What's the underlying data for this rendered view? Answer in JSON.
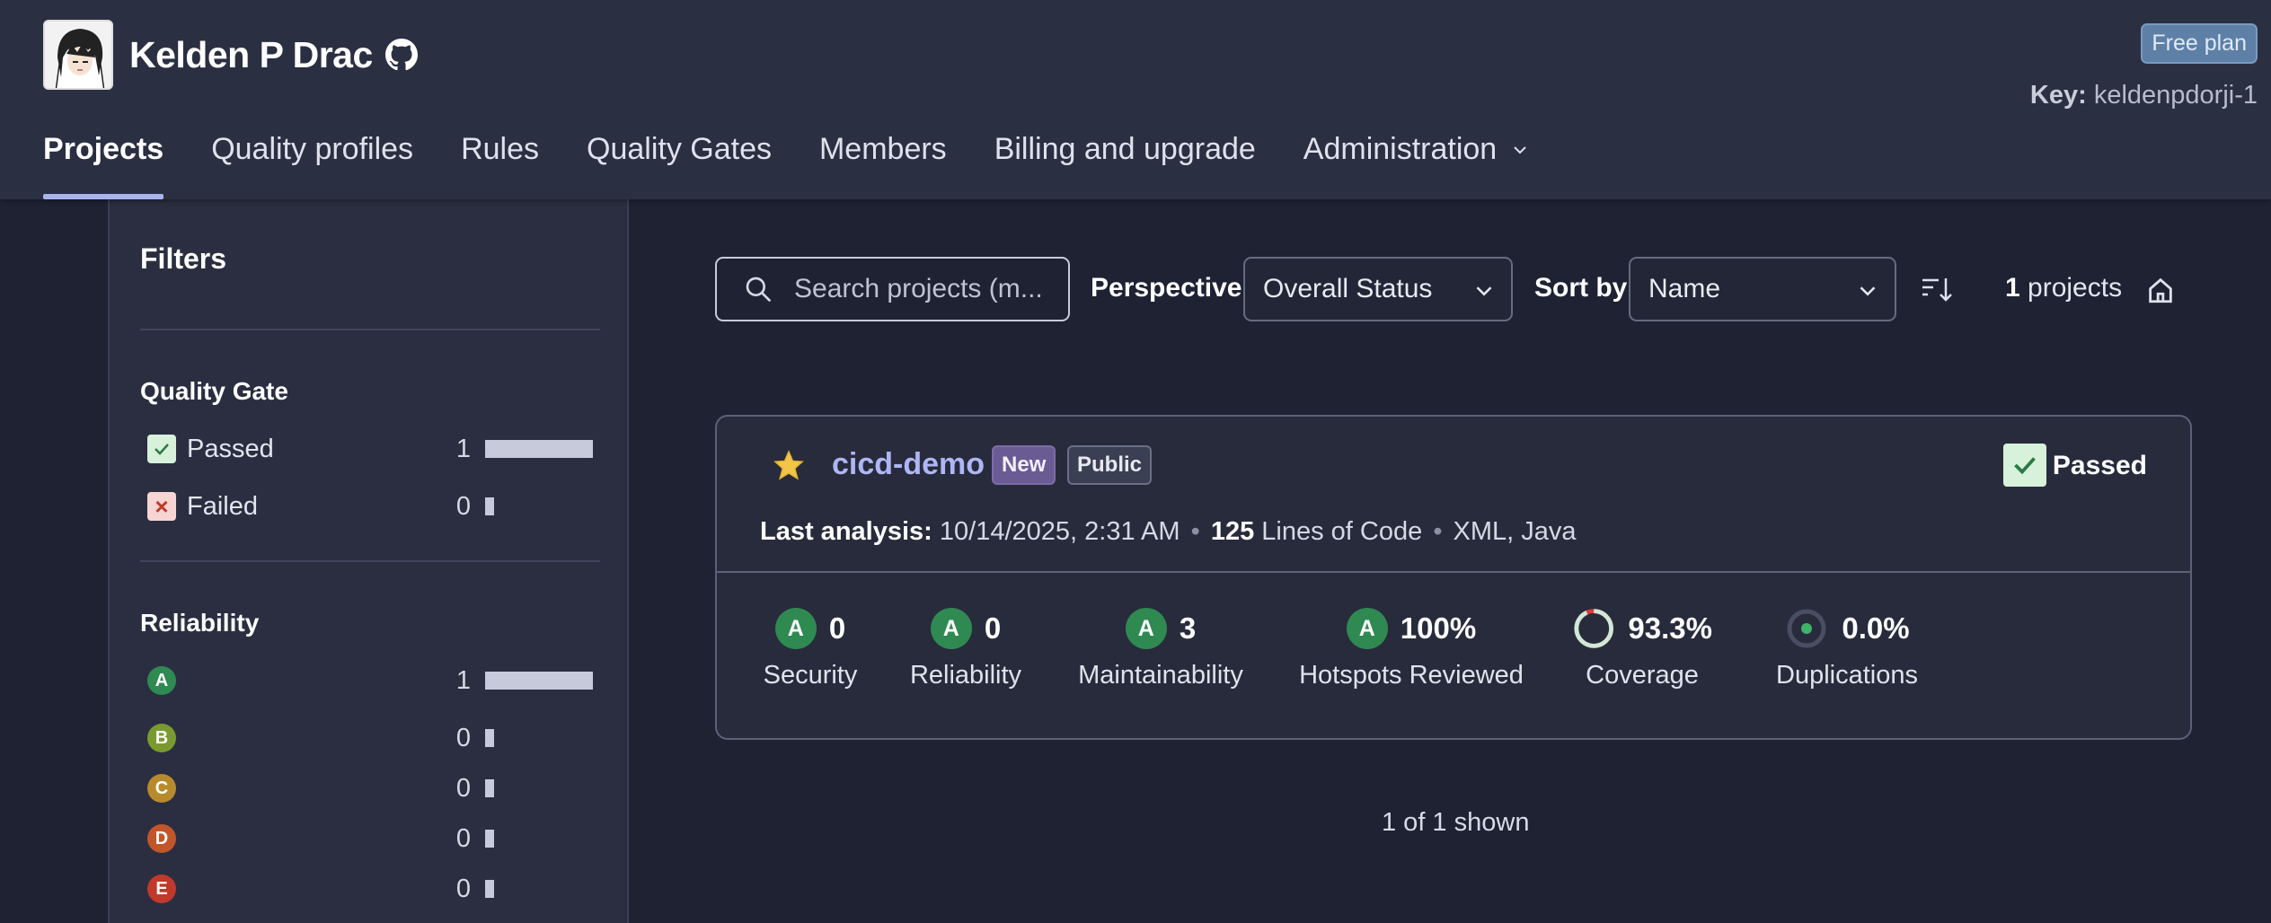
{
  "org": {
    "name": "Kelden P Drac",
    "plan": "Free plan",
    "key_label": "Key:",
    "key_value": "keldenpdorji-1"
  },
  "nav": {
    "items": [
      "Projects",
      "Quality profiles",
      "Rules",
      "Quality Gates",
      "Members",
      "Billing and upgrade",
      "Administration"
    ],
    "active": "Projects"
  },
  "filters": {
    "title": "Filters",
    "quality_gate": {
      "title": "Quality Gate",
      "items": [
        {
          "label": "Passed",
          "count": "1",
          "fraction": 1.0
        },
        {
          "label": "Failed",
          "count": "0",
          "fraction": 0.0
        }
      ]
    },
    "reliability": {
      "title": "Reliability",
      "items": [
        {
          "grade": "A",
          "count": "1",
          "fraction": 1.0,
          "color": "#2f8a52"
        },
        {
          "grade": "B",
          "count": "0",
          "fraction": 0.0,
          "color": "#7a9a2f"
        },
        {
          "grade": "C",
          "count": "0",
          "fraction": 0.0,
          "color": "#b78a2c"
        },
        {
          "grade": "D",
          "count": "0",
          "fraction": 0.0,
          "color": "#c1562a"
        },
        {
          "grade": "E",
          "count": "0",
          "fraction": 0.0,
          "color": "#c0392b"
        }
      ]
    }
  },
  "toolbar": {
    "search_placeholder": "Search projects (m...",
    "perspective_label": "Perspective",
    "perspective_value": "Overall Status",
    "sort_label": "Sort by",
    "sort_value": "Name",
    "count_number": "1",
    "count_suffix": "projects"
  },
  "project": {
    "name": "cicd-demo",
    "badge_new": "New",
    "badge_public": "Public",
    "quality_gate": "Passed",
    "last_analysis_label": "Last analysis:",
    "last_analysis_value": "10/14/2025, 2:31 AM",
    "loc_value": "125",
    "loc_label": "Lines of Code",
    "languages": "XML, Java",
    "measures": [
      {
        "label": "Security",
        "rating": "A",
        "value": "0"
      },
      {
        "label": "Reliability",
        "rating": "A",
        "value": "0"
      },
      {
        "label": "Maintainability",
        "rating": "A",
        "value": "3"
      },
      {
        "label": "Hotspots Reviewed",
        "rating": "A",
        "value": "100%"
      },
      {
        "label": "Coverage",
        "value": "93.3%",
        "percent": 93.3
      },
      {
        "label": "Duplications",
        "value": "0.0%",
        "percent": 0.0
      }
    ]
  },
  "footer": {
    "shown": "1 of 1 shown"
  },
  "colors": {
    "accent": "#a9b4ee",
    "rating_a": "#2f8a52",
    "passed_bg": "#d7f1da",
    "coverage_ring": "#cfe9d6"
  }
}
